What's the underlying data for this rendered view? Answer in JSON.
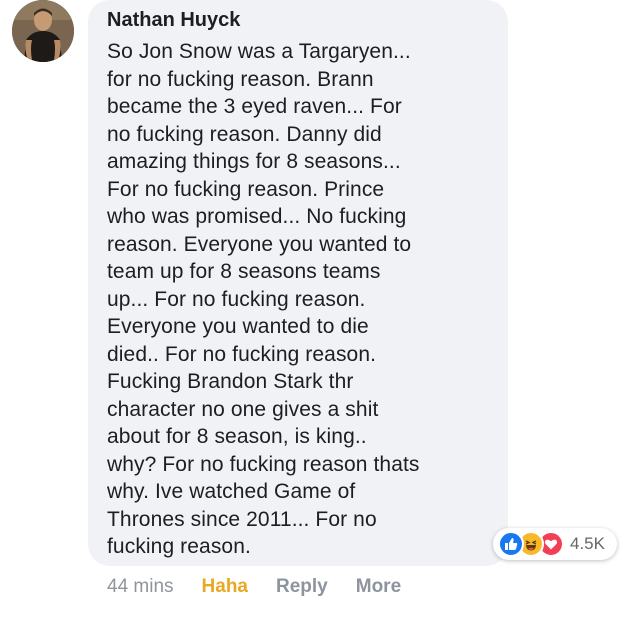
{
  "comment": {
    "author": "Nathan Huyck",
    "text": "So Jon Snow was a Targaryen...\nfor no fucking reason. Brann\nbecame the 3 eyed raven... For\nno fucking reason. Danny did\namazing things for 8 seasons...\nFor no fucking reason. Prince\nwho was promised... No fucking\nreason. Everyone you wanted to\nteam up for 8 seasons teams\nup... For no fucking reason.\nEveryone you wanted to die\ndied.. For no fucking reason.\nFucking Brandon Stark thr\ncharacter no one gives a shit\nabout for 8 season, is king..\nwhy? For no fucking reason thats\nwhy. Ive watched Game of\nThrones since 2011... For no\nfucking reason."
  },
  "reactions": {
    "icons": [
      "like-icon",
      "haha-icon",
      "love-icon"
    ],
    "count": "4.5K",
    "colors": {
      "like": "#1877f2",
      "haha": "#f7b928",
      "love": "#f33e58"
    }
  },
  "actions": {
    "timestamp": "44 mins",
    "haha_label": "Haha",
    "reply_label": "Reply",
    "more_label": "More"
  },
  "colors": {
    "bubble": "#f0f2f5",
    "text": "#1c1e21",
    "haha_active": "#e9a821",
    "muted": "#8d949e"
  }
}
